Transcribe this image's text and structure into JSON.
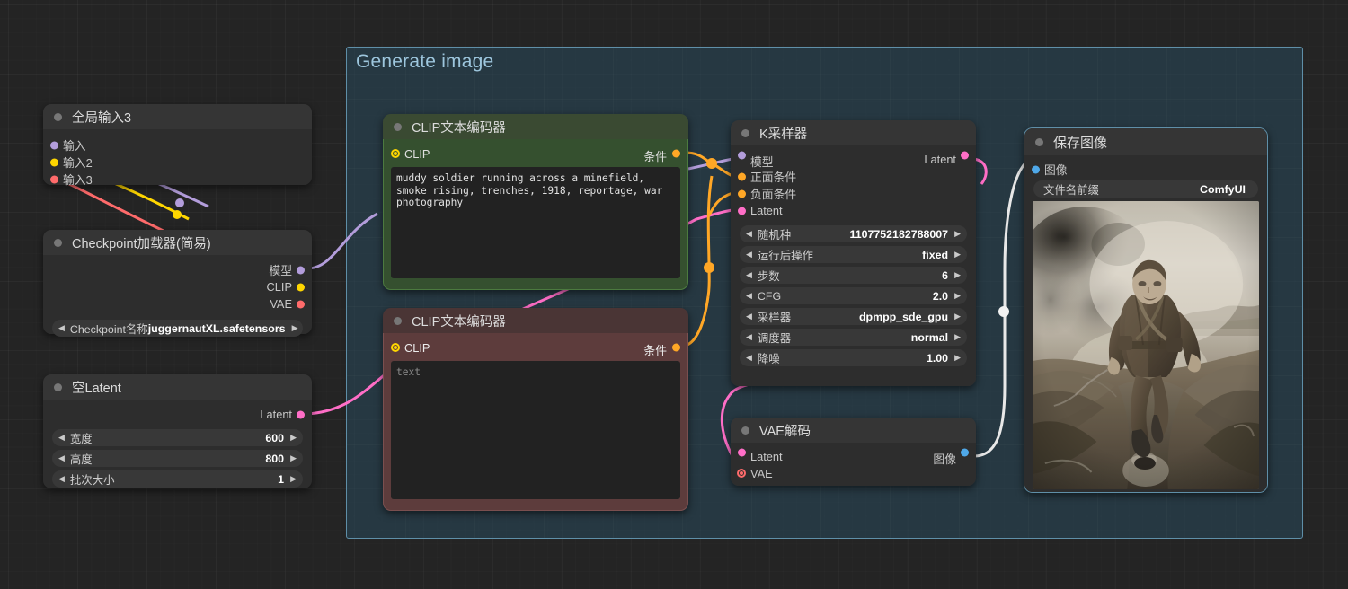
{
  "canvas": {
    "background_color": "#242424"
  },
  "group": {
    "title": "Generate image",
    "color": "#5f8fa8"
  },
  "nodes": {
    "global_input": {
      "title": "全局输入3",
      "inputs": [
        {
          "label": "输入",
          "color": "#b39ddb"
        },
        {
          "label": "输入2",
          "color": "#ffd600"
        },
        {
          "label": "输入3",
          "color": "#ff6b6b"
        }
      ]
    },
    "checkpoint_loader": {
      "title": "Checkpoint加载器(简易)",
      "outputs": [
        {
          "label": "模型",
          "color": "#b39ddb"
        },
        {
          "label": "CLIP",
          "color": "#ffd600"
        },
        {
          "label": "VAE",
          "color": "#ff6b6b"
        }
      ],
      "widgets": [
        {
          "label": "Checkpoint名称",
          "value": "juggernautXL.safetensors"
        }
      ]
    },
    "empty_latent": {
      "title": "空Latent",
      "outputs": [
        {
          "label": "Latent",
          "color": "#ff6ec7"
        }
      ],
      "widgets": [
        {
          "label": "宽度",
          "value": "600"
        },
        {
          "label": "高度",
          "value": "800"
        },
        {
          "label": "批次大小",
          "value": "1"
        }
      ]
    },
    "clip_positive": {
      "title": "CLIP文本编码器",
      "input": {
        "label": "CLIP",
        "color": "#ffd600"
      },
      "output": {
        "label": "条件",
        "color": "#ffa726"
      },
      "text": "muddy soldier running across a minefield, smoke rising, trenches, 1918, reportage, war photography",
      "placeholder": ""
    },
    "clip_negative": {
      "title": "CLIP文本编码器",
      "input": {
        "label": "CLIP",
        "color": "#ffd600"
      },
      "output": {
        "label": "条件",
        "color": "#ffa726"
      },
      "text": "",
      "placeholder": "text"
    },
    "ksampler": {
      "title": "K采样器",
      "inputs": [
        {
          "label": "模型",
          "color": "#b39ddb"
        },
        {
          "label": "正面条件",
          "color": "#ffa726"
        },
        {
          "label": "负面条件",
          "color": "#ffa726"
        },
        {
          "label": "Latent",
          "color": "#ff6ec7"
        }
      ],
      "outputs": [
        {
          "label": "Latent",
          "color": "#ff6ec7"
        }
      ],
      "widgets": [
        {
          "label": "随机种",
          "value": "1107752182788007"
        },
        {
          "label": "运行后操作",
          "value": "fixed"
        },
        {
          "label": "步数",
          "value": "6"
        },
        {
          "label": "CFG",
          "value": "2.0"
        },
        {
          "label": "采样器",
          "value": "dpmpp_sde_gpu"
        },
        {
          "label": "调度器",
          "value": "normal"
        },
        {
          "label": "降噪",
          "value": "1.00"
        }
      ]
    },
    "vae_decode": {
      "title": "VAE解码",
      "inputs": [
        {
          "label": "Latent",
          "color": "#ff6ec7"
        },
        {
          "label": "VAE",
          "color": "#ff6b6b"
        }
      ],
      "outputs": [
        {
          "label": "图像",
          "color": "#4fa8e8"
        }
      ]
    },
    "save_image": {
      "title": "保存图像",
      "inputs": [
        {
          "label": "图像",
          "color": "#4fa8e8"
        }
      ],
      "widgets": [
        {
          "label": "文件名前缀",
          "value": "ComfyUI"
        }
      ],
      "preview_alt": "Black and white war photograph of a muddy soldier running across a trench with smoke rising"
    }
  }
}
